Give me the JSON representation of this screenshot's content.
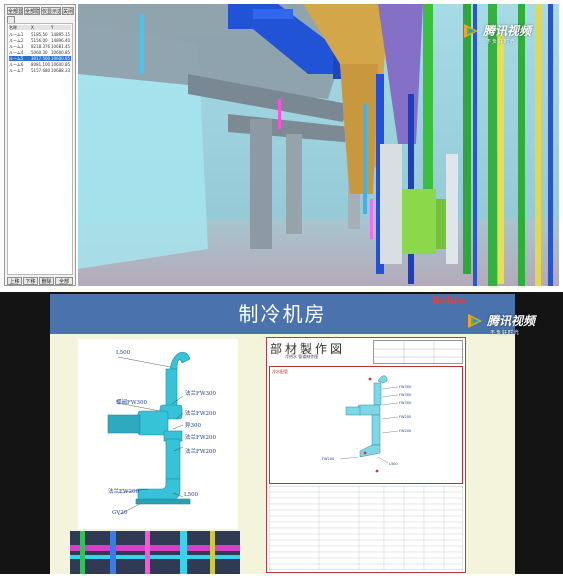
{
  "left_panel": {
    "buttons": [
      "全部显示",
      "全部隐藏",
      "仅显示选中",
      "关闭"
    ],
    "tree_header": [
      "名称",
      "X",
      "Y"
    ],
    "tree_rows": [
      {
        "name": "ルーム1",
        "x": "5185.50",
        "y": "14895.15"
      },
      {
        "name": "ルーム2",
        "x": "5156.00",
        "y": "14896.40"
      },
      {
        "name": "ルーム3",
        "x": "8218.376",
        "y": "10681.45"
      },
      {
        "name": "ルーム4",
        "x": "5060.30",
        "y": "10600.85"
      },
      {
        "name": "ルーム5",
        "x": "3017.500",
        "y": "10600.85"
      },
      {
        "name": "ルーム6",
        "x": "8081.100",
        "y": "10600.85"
      },
      {
        "name": "ルーム7",
        "x": "5157.680",
        "y": "10688.33"
      }
    ],
    "selected_index": 4,
    "bottom_buttons": [
      "上移",
      "下移",
      "删除",
      "全部"
    ]
  },
  "slide": {
    "title": "制冷机房",
    "badge": "Rebro",
    "left_labels": {
      "top": "L500",
      "flange1": "法兰FW300",
      "valve1": "蝶阀FW300",
      "flange2": "法兰FW200",
      "reducer": "异300",
      "flange3": "法兰FW200",
      "flange4": "法兰FW200",
      "bottom": "L500",
      "base": "GV20"
    },
    "sheet_title": "部材製作図",
    "sheet_tag": "冷水配管",
    "sheet_subtitle": "冷热水 管道制作图"
  },
  "watermark": {
    "text": "腾讯视频",
    "subtext": "不负好时光"
  },
  "colors": {
    "slide_title_bar": "#4a72ac",
    "accent_pipe": "#36c3d8",
    "watermark_logo_orange": "#f7a21b",
    "watermark_logo_green": "#41c05a",
    "watermark_logo_blue": "#2b8ef0",
    "selection": "#2f6fd0"
  }
}
